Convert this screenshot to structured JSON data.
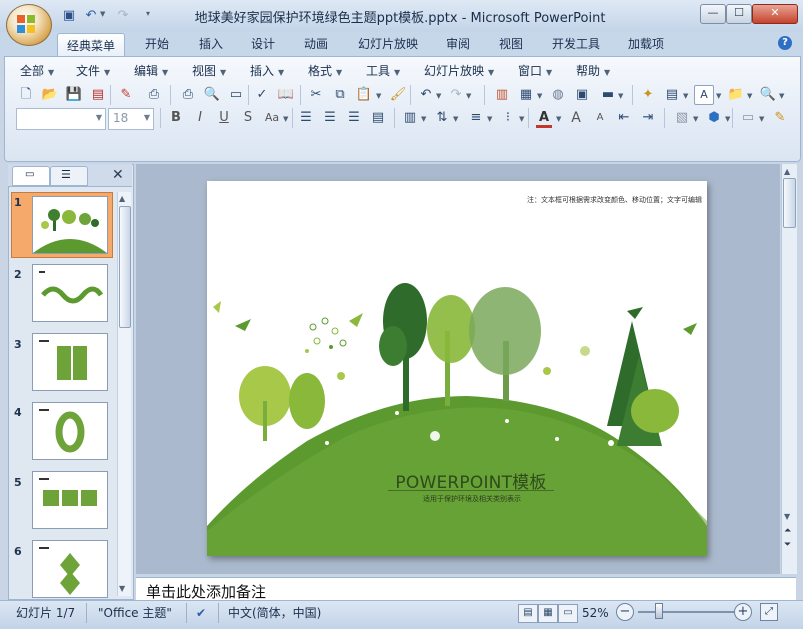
{
  "window": {
    "title": "地球美好家园保护环境绿色主题ppt模板.pptx - Microsoft PowerPoint",
    "controls": [
      "—",
      "☐",
      "✕"
    ]
  },
  "ribbon": {
    "tabs": [
      "经典菜单",
      "开始",
      "插入",
      "设计",
      "动画",
      "幻灯片放映",
      "审阅",
      "视图",
      "开发工具",
      "加载项"
    ],
    "active_tab": "经典菜单",
    "menus": [
      "全部",
      "文件",
      "编辑",
      "视图",
      "插入",
      "格式",
      "工具",
      "幻灯片放映",
      "窗口",
      "帮助"
    ],
    "font_name_value": "",
    "font_size_value": "18",
    "text_color_label": "A"
  },
  "panel": {
    "slide_numbers": [
      "1",
      "2",
      "3",
      "4",
      "5",
      "6"
    ]
  },
  "slide": {
    "note": "注：文本框可根据需求改变颜色、移动位置；文字可编辑",
    "title": "POWERPOINT模板",
    "subtitle": "适用于保护环境及相关类别表示"
  },
  "notes": {
    "placeholder": "单击此处添加备注"
  },
  "status": {
    "slide_counter": "幻灯片 1/7",
    "theme": "\"Office 主题\"",
    "language": "中文(简体，中国)",
    "zoom": "52%",
    "zoom_level": 52
  },
  "colors": {
    "hill_green": "#5c9a2f",
    "tree_dark": "#2f6b2a",
    "tree_light": "#8ab83a",
    "accent_orange": "#f5a96a"
  }
}
